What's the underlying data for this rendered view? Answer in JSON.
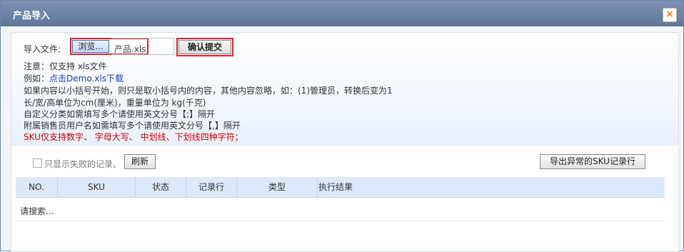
{
  "dialog": {
    "title": "产品导入",
    "close_icon": "×"
  },
  "upload": {
    "label": "导入文件:",
    "browse_label": "浏览...",
    "file_value": "产品.xls",
    "confirm_label": "确认提交"
  },
  "notes": {
    "line1": "注意：仅支持 xls文件",
    "line2_prefix": "例如：",
    "line2_link": "点击Demo.xls下载",
    "line3": "如果内容以小括号开始，则只是取小括号内的内容，其他内容忽略，如：(1)管理员，转换后变为1",
    "line4": "长/宽/高单位为cm(厘米)，重量单位为 kg(千克)",
    "line5": "自定义分类如需填写多个请使用英文分号【;】隔开",
    "line6": "附属销售员用户名如需填写多个请使用英文分号【,】隔开",
    "line7": "SKU仅支持数字、 字母大写、 中划线、下划线四种字符；"
  },
  "toolbar": {
    "checkbox_label": "只显示失败的记录。",
    "refresh_label": "刷新",
    "export_label": "导出异常的SKU记录行"
  },
  "table": {
    "columns": [
      "NO.",
      "SKU",
      "状态",
      "记录行",
      "类型",
      "执行结果"
    ],
    "empty_text": "请搜索..."
  },
  "colors": {
    "titlebar": "#6b82a8",
    "highlight": "#e0232a",
    "link": "#1a3cc8",
    "warning": "#d20000",
    "table_header": "#dce9f9"
  }
}
